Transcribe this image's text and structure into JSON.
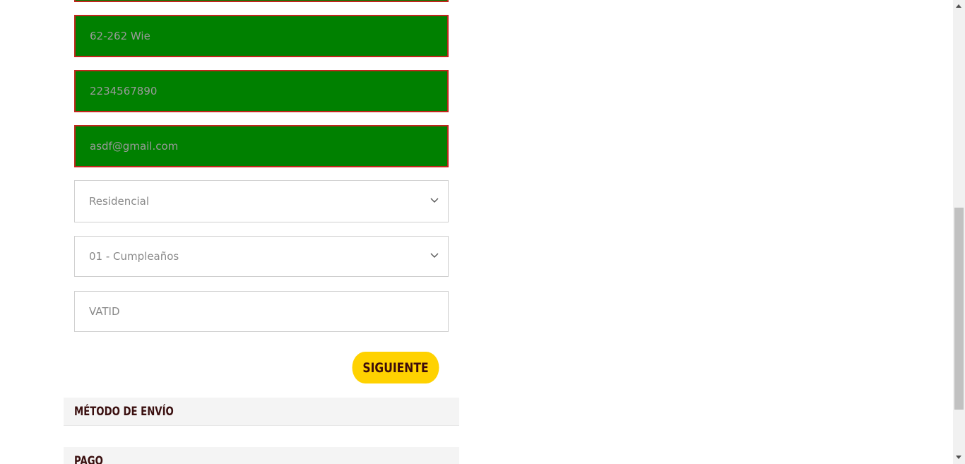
{
  "form": {
    "address_value": "62-262 Wie",
    "phone_value": "2234567890",
    "email_value": "asdf@gmail.com",
    "address_type_selected": "Residencial",
    "occasion_selected": "01 - Cumpleaños",
    "vatid_placeholder": "VATID",
    "next_button_label": "SIGUIENTE"
  },
  "sections": {
    "shipping_method_label": "MÉTODO DE ENVÍO",
    "payment_label": "PAGO"
  },
  "colors": {
    "valid_field_bg": "#008000",
    "valid_field_border": "#c0271c",
    "button_bg": "#ffd200",
    "heading_text": "#3a0f0f"
  }
}
